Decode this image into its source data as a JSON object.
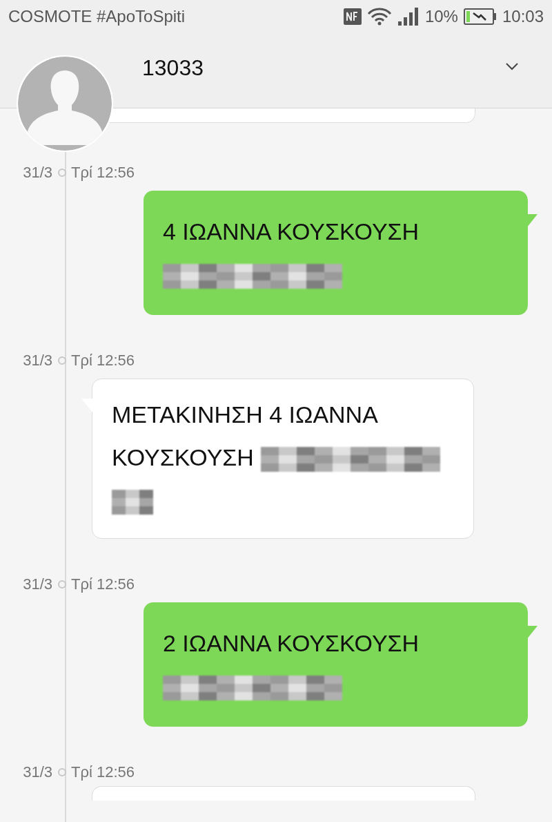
{
  "status_bar": {
    "carrier": "COSMOTE #ApoToSpiti",
    "battery_percent": "10%",
    "time": "10:03"
  },
  "header": {
    "title": "13033"
  },
  "messages": [
    {
      "date": "31/3",
      "time": "Τρί 12:56",
      "kind": "sent",
      "parts": [
        {
          "kind": "text",
          "text": "4 ΙΩΑΝΝΑ ΚΟΥΣΚΟΥΣΗ"
        },
        {
          "kind": "redacted"
        }
      ]
    },
    {
      "date": "31/3",
      "time": "Τρί 12:56",
      "kind": "received",
      "parts": [
        {
          "kind": "text",
          "text": "ΜΕΤΑΚΙΝΗΣΗ 4 ΙΩΑΝΝΑ"
        },
        {
          "kind": "text",
          "text": "ΚΟΥΣΚΟΥΣΗ"
        },
        {
          "kind": "redacted"
        },
        {
          "kind": "redacted_short"
        }
      ]
    },
    {
      "date": "31/3",
      "time": "Τρί 12:56",
      "kind": "sent",
      "parts": [
        {
          "kind": "text",
          "text": "2 ΙΩΑΝΝΑ ΚΟΥΣΚΟΥΣΗ"
        },
        {
          "kind": "redacted"
        }
      ]
    },
    {
      "date": "31/3",
      "time": "Τρί 12:56",
      "kind": "received_cut"
    }
  ]
}
